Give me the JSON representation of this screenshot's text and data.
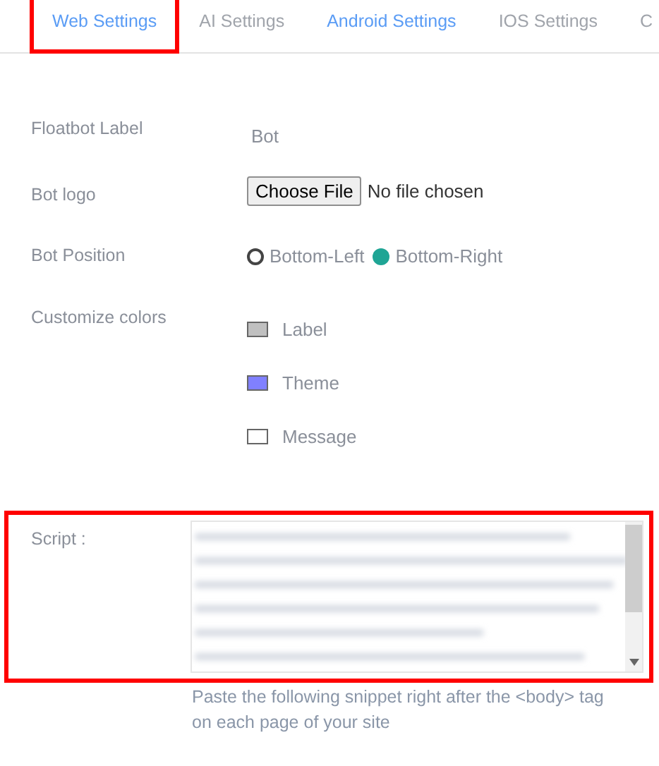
{
  "tabs": [
    {
      "label": "Web Settings",
      "highlighted": true,
      "color": "#5a9cf5"
    },
    {
      "label": "AI Settings",
      "highlighted": false,
      "color": "#a0a4ab"
    },
    {
      "label": "Android Settings",
      "highlighted": false,
      "color": "#5a9cf5"
    },
    {
      "label": "IOS Settings",
      "highlighted": false,
      "color": "#a0a4ab"
    },
    {
      "label": "C",
      "highlighted": false,
      "color": "#a0a4ab"
    }
  ],
  "floatbot_label": {
    "label": "Floatbot Label",
    "value": "Bot"
  },
  "bot_logo": {
    "label": "Bot logo",
    "button": "Choose File",
    "status": "No file chosen"
  },
  "bot_position": {
    "label": "Bot Position",
    "options": [
      {
        "label": "Bottom-Left",
        "selected": false
      },
      {
        "label": "Bottom-Right",
        "selected": true
      }
    ]
  },
  "colors": {
    "label": "Customize colors",
    "items": [
      {
        "label": "Label",
        "color": "#c0c0c0"
      },
      {
        "label": "Theme",
        "color": "#8080ff"
      },
      {
        "label": "Message",
        "color": "#ffffff"
      }
    ]
  },
  "script": {
    "label": "Script :",
    "highlighted": true,
    "help": "Paste the following snippet right after the <body> tag on each page of your site"
  }
}
